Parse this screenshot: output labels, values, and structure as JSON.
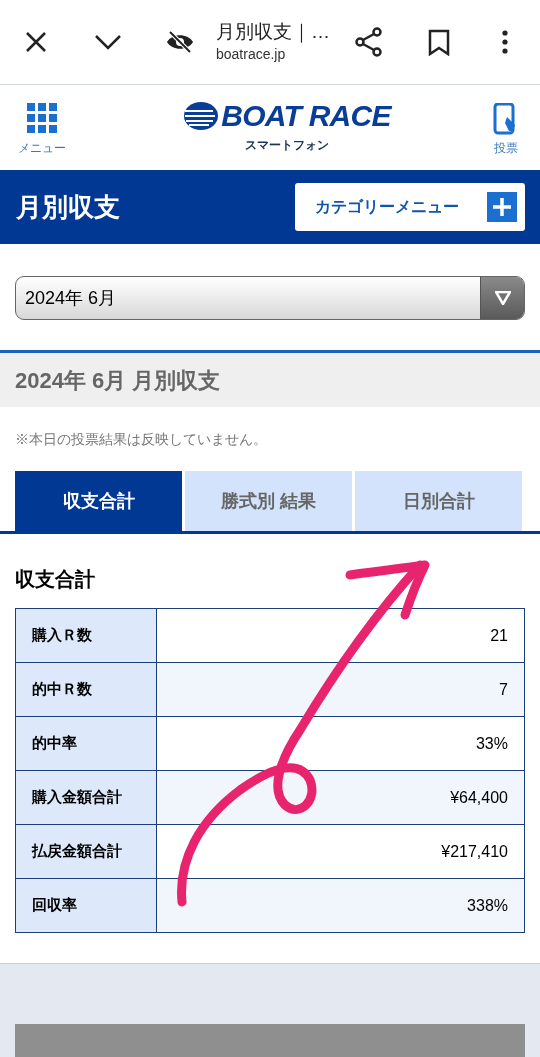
{
  "browser_bar": {
    "title": "月別収支｜…",
    "url": "boatrace.jp"
  },
  "header": {
    "menu_label": "メニュー",
    "logo_text": "BOAT RACE",
    "logo_sub": "スマートフォン",
    "vote_label": "投票"
  },
  "page_title": "月別収支",
  "category_button": "カテゴリーメニュー",
  "month_select": {
    "value": "2024年 6月"
  },
  "section_heading": "2024年 6月 月別収支",
  "note": "※本日の投票結果は反映していません。",
  "tabs": [
    {
      "label": "収支合計",
      "selected": true
    },
    {
      "label": "勝式別 結果",
      "selected": false
    },
    {
      "label": "日別合計",
      "selected": false
    }
  ],
  "summary": {
    "title": "収支合計",
    "rows": [
      {
        "label": "購入Ｒ数",
        "value": "21"
      },
      {
        "label": "的中Ｒ数",
        "value": "7"
      },
      {
        "label": "的中率",
        "value": "33%"
      },
      {
        "label": "購入金額合計",
        "value": "¥64,400"
      },
      {
        "label": "払戻金額合計",
        "value": "¥217,410"
      },
      {
        "label": "回収率",
        "value": "338%"
      }
    ]
  }
}
